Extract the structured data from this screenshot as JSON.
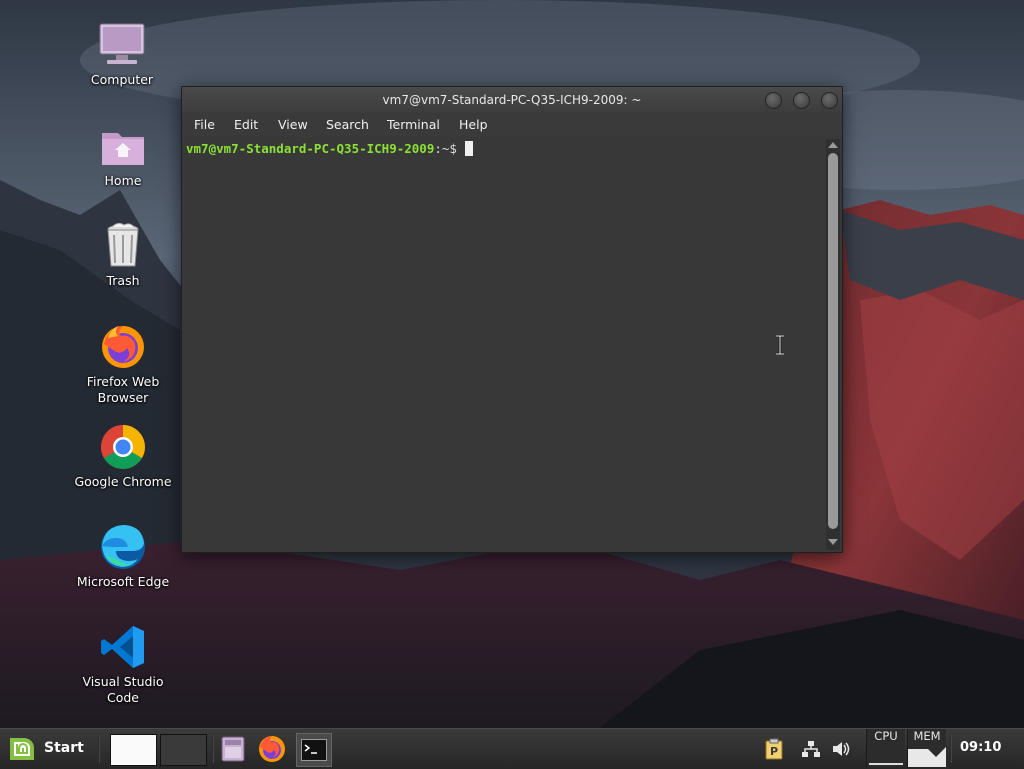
{
  "desktop": {
    "icons": [
      {
        "label": "Computer",
        "icon": "computer-icon"
      },
      {
        "label": "Home",
        "icon": "home-folder-icon"
      },
      {
        "label": "Trash",
        "icon": "trash-icon"
      },
      {
        "label": "Firefox Web Browser",
        "icon": "firefox-icon"
      },
      {
        "label": "Google Chrome",
        "icon": "chrome-icon"
      },
      {
        "label": "Microsoft Edge",
        "icon": "edge-icon"
      },
      {
        "label": "Visual Studio Code",
        "icon": "vscode-icon"
      }
    ]
  },
  "terminal": {
    "title": "vm7@vm7-Standard-PC-Q35-ICH9-2009: ~",
    "menu": [
      "File",
      "Edit",
      "View",
      "Search",
      "Terminal",
      "Help"
    ],
    "prompt_user": "vm7@vm7-Standard-PC-Q35-ICH9-2009",
    "prompt_suffix": ":~$ "
  },
  "taskbar": {
    "start_label": "Start",
    "cpu_label": "CPU",
    "mem_label": "MEM",
    "clock": "09:10",
    "launchers": [
      "file-manager-icon",
      "firefox-icon",
      "terminal-icon"
    ],
    "tray": [
      "clipboard-icon",
      "network-icon",
      "volume-icon"
    ]
  },
  "colors": {
    "prompt_green": "#8ae234",
    "terminal_bg": "#383838",
    "taskbar_bg": "#2a2a2a",
    "mint_green": "#86be43"
  }
}
